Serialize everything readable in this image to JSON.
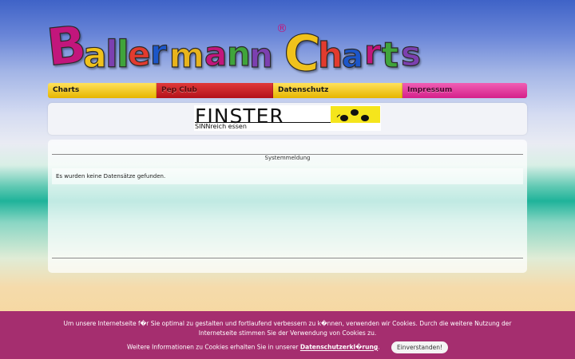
{
  "logo": {
    "text": "BallermannCharts",
    "registered": "®"
  },
  "nav": {
    "items": [
      {
        "label": "Charts"
      },
      {
        "label": "Pep Club"
      },
      {
        "label": "Datenschutz"
      },
      {
        "label": "Impressum"
      }
    ]
  },
  "banner": {
    "name": "FINSTER",
    "tagline": "SINNreich essen"
  },
  "main": {
    "system_title": "Systemmeldung",
    "message": "Es wurden keine Datensätze gefunden."
  },
  "cookie": {
    "line1": "Um unsere Internetseite f�r Sie optimal zu gestalten und fortlaufend verbessern zu k�nnen, verwenden wir Cookies. Durch die weitere Nutzung der",
    "line2": "Internetseite stimmen Sie der Verwendung von Cookies zu.",
    "info_text": "Weitere Informationen zu Cookies erhalten Sie in unserer ",
    "link_label": "Datenschutzerkl�rung",
    "info_after": ".",
    "accept_label": "Einverstanden!"
  },
  "colors": {
    "nav_yellow": "#f2c200",
    "nav_red": "#c8161e",
    "nav_pink": "#e43d9e",
    "cookie_bg": "#a52e6f"
  }
}
